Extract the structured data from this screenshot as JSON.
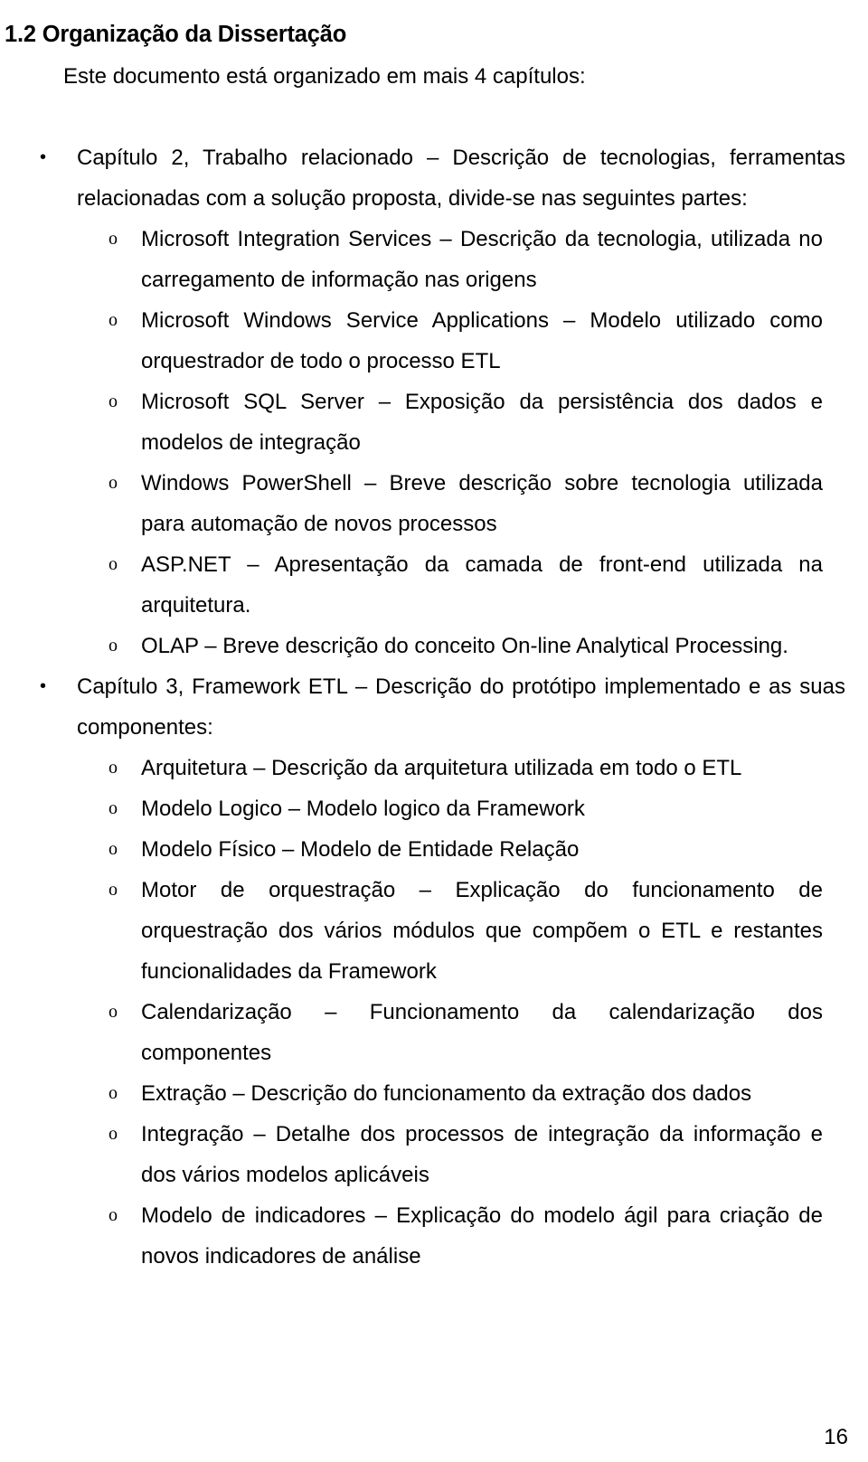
{
  "document": {
    "heading": "1.2 Organização da Dissertação",
    "intro": "Este documento está organizado em mais 4 capítulos:",
    "page_number": "16",
    "bullet_markers": {
      "level1": "•",
      "level2": "o"
    },
    "sections": [
      {
        "id": "capitulo-2",
        "text": "Capítulo 2, Trabalho relacionado – Descrição de tecnologias, ferramentas relacionadas com a solução proposta, divide-se nas seguintes partes:",
        "subitems": [
          {
            "id": "microsoft-integration-services",
            "text": "Microsoft Integration Services – Descrição da tecnologia, utilizada no carregamento de informação nas origens"
          },
          {
            "id": "microsoft-windows-service-applications",
            "text": "Microsoft Windows Service Applications – Modelo utilizado como orquestrador de todo o processo ETL"
          },
          {
            "id": "microsoft-sql-server",
            "text": "Microsoft SQL Server – Exposição da persistência dos dados e modelos de integração"
          },
          {
            "id": "windows-powershell",
            "text": "Windows PowerShell – Breve descrição sobre tecnologia utilizada para automação de novos processos"
          },
          {
            "id": "asp-net",
            "text": "ASP.NET – Apresentação da camada de front-end utilizada na arquitetura."
          },
          {
            "id": "olap",
            "text": "OLAP – Breve descrição do conceito On-line Analytical Processing."
          }
        ]
      },
      {
        "id": "capitulo-3",
        "text": "Capítulo 3, Framework ETL – Descrição do protótipo implementado e as suas componentes:",
        "subitems": [
          {
            "id": "arquitetura",
            "text": "Arquitetura – Descrição da arquitetura utilizada em todo o ETL"
          },
          {
            "id": "modelo-logico",
            "text": "Modelo Logico – Modelo logico da Framework"
          },
          {
            "id": "modelo-fisico",
            "text": "Modelo Físico – Modelo de Entidade Relação"
          },
          {
            "id": "motor-de-orquestracao",
            "text": "Motor de orquestração – Explicação do funcionamento de orquestração dos vários módulos que compõem o ETL e restantes funcionalidades da Framework"
          },
          {
            "id": "calendarizacao",
            "text": "Calendarização – Funcionamento da calendarização dos componentes"
          },
          {
            "id": "extracao",
            "text": "Extração – Descrição do funcionamento da extração dos dados"
          },
          {
            "id": "integracao",
            "text": "Integração – Detalhe dos processos de integração da informação e dos vários modelos aplicáveis"
          },
          {
            "id": "modelo-de-indicadores",
            "text": "Modelo de indicadores – Explicação do modelo ágil para criação de novos indicadores de análise"
          }
        ]
      }
    ]
  }
}
